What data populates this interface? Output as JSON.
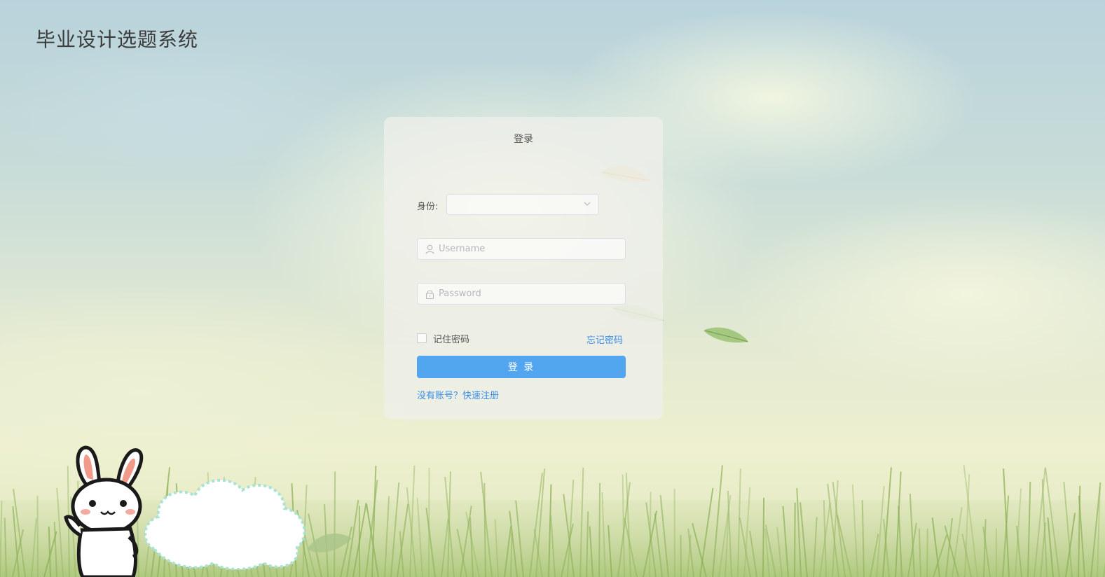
{
  "app": {
    "title": "毕业设计选题系统"
  },
  "login": {
    "title": "登录",
    "role_label": "身份:",
    "role_value": "",
    "username_placeholder": "Username",
    "password_placeholder": "Password",
    "remember_label": "记住密码",
    "remember_checked": false,
    "forgot_label": "忘记密码",
    "submit_label": "登 录",
    "register_label": "没有账号？快速注册"
  },
  "icons": {
    "user": "user-icon",
    "lock": "lock-icon",
    "chevron": "chevron-down-icon"
  },
  "colors": {
    "primary": "#52a5ef",
    "link": "#3a8ee6"
  }
}
